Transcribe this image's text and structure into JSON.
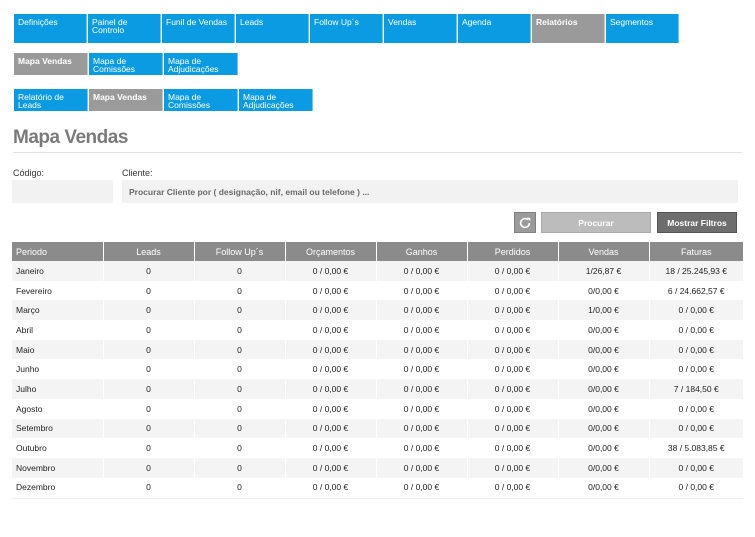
{
  "nav_main": [
    {
      "label": "Definições",
      "active": false
    },
    {
      "label": "Painel de Controlo",
      "active": false
    },
    {
      "label": "Funil de Vendas",
      "active": false
    },
    {
      "label": "Leads",
      "active": false
    },
    {
      "label": "Follow Up´s",
      "active": false
    },
    {
      "label": "Vendas",
      "active": false
    },
    {
      "label": "Agenda",
      "active": false
    },
    {
      "label": "Relatórios",
      "active": true
    },
    {
      "label": "Segmentos",
      "active": false
    }
  ],
  "nav_sub": [
    {
      "label": "Mapa Vendas",
      "active": true
    },
    {
      "label": "Mapa de Comissões",
      "active": false
    },
    {
      "label": "Mapa de Adjudicações",
      "active": false
    }
  ],
  "nav_sub2": [
    {
      "label": "Relatório de Leads",
      "active": false
    },
    {
      "label": "Mapa Vendas",
      "active": true
    },
    {
      "label": "Mapa de Comissões",
      "active": false
    },
    {
      "label": "Mapa de Adjudicações",
      "active": false
    }
  ],
  "page_title": "Mapa Vendas",
  "filters": {
    "codigo_label": "Código:",
    "codigo_value": "",
    "cliente_label": "Cliente:",
    "cliente_placeholder": "Procurar Cliente por ( designação, nif, email ou telefone ) ...",
    "procurar_label": "Procurar",
    "filtros_label": "Mostrar Filtros",
    "refresh_icon": "refresh-icon"
  },
  "table": {
    "columns": [
      "Periodo",
      "Leads",
      "Follow Up´s",
      "Orçamentos",
      "Ganhos",
      "Perdidos",
      "Vendas",
      "Faturas"
    ],
    "rows": [
      [
        "Janeiro",
        "0",
        "0",
        "0 / 0,00 €",
        "0 / 0,00 €",
        "0 / 0,00 €",
        "1/26,87 €",
        "18 / 25.245,93 €"
      ],
      [
        "Fevereiro",
        "0",
        "0",
        "0 / 0,00 €",
        "0 / 0,00 €",
        "0 / 0,00 €",
        "0/0,00 €",
        "6 / 24.662,57 €"
      ],
      [
        "Março",
        "0",
        "0",
        "0 / 0,00 €",
        "0 / 0,00 €",
        "0 / 0,00 €",
        "1/0,00 €",
        "0 / 0,00 €"
      ],
      [
        "Abril",
        "0",
        "0",
        "0 / 0,00 €",
        "0 / 0,00 €",
        "0 / 0,00 €",
        "0/0,00 €",
        "0 / 0,00 €"
      ],
      [
        "Maio",
        "0",
        "0",
        "0 / 0,00 €",
        "0 / 0,00 €",
        "0 / 0,00 €",
        "0/0,00 €",
        "0 / 0,00 €"
      ],
      [
        "Junho",
        "0",
        "0",
        "0 / 0,00 €",
        "0 / 0,00 €",
        "0 / 0,00 €",
        "0/0,00 €",
        "0 / 0,00 €"
      ],
      [
        "Julho",
        "0",
        "0",
        "0 / 0,00 €",
        "0 / 0,00 €",
        "0 / 0,00 €",
        "0/0,00 €",
        "7 / 184,50 €"
      ],
      [
        "Agosto",
        "0",
        "0",
        "0 / 0,00 €",
        "0 / 0,00 €",
        "0 / 0,00 €",
        "0/0,00 €",
        "0 / 0,00 €"
      ],
      [
        "Setembro",
        "0",
        "0",
        "0 / 0,00 €",
        "0 / 0,00 €",
        "0 / 0,00 €",
        "0/0,00 €",
        "0 / 0,00 €"
      ],
      [
        "Outubro",
        "0",
        "0",
        "0 / 0,00 €",
        "0 / 0,00 €",
        "0 / 0,00 €",
        "0/0,00 €",
        "38 / 5.083,85 €"
      ],
      [
        "Novembro",
        "0",
        "0",
        "0 / 0,00 €",
        "0 / 0,00 €",
        "0 / 0,00 €",
        "0/0,00 €",
        "0 / 0,00 €"
      ],
      [
        "Dezembro",
        "0",
        "0",
        "0 / 0,00 €",
        "0 / 0,00 €",
        "0 / 0,00 €",
        "0/0,00 €",
        "0 / 0,00 €"
      ]
    ]
  }
}
